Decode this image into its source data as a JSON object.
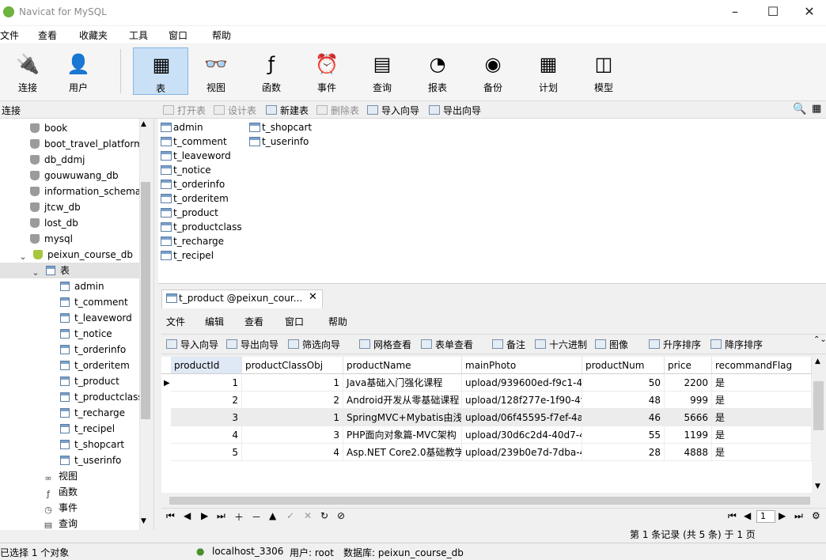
{
  "window": {
    "title": "Navicat for MySQL"
  },
  "menu": [
    "文件",
    "查看",
    "收藏夹",
    "工具",
    "窗口",
    "帮助"
  ],
  "toolbar": [
    "连接",
    "用户",
    "表",
    "视图",
    "函数",
    "事件",
    "查询",
    "报表",
    "备份",
    "计划",
    "模型"
  ],
  "object_bar": {
    "connection_label": "连接",
    "buttons": [
      "打开表",
      "设计表",
      "新建表",
      "删除表",
      "导入向导",
      "导出向导"
    ]
  },
  "tree": {
    "databases": [
      "book",
      "boot_travel_platform",
      "db_ddmj",
      "gouwuwang_db",
      "information_schema",
      "jtcw_db",
      "lost_db",
      "mysql",
      "peixun_course_db"
    ],
    "tables_folder": "表",
    "tables": [
      "admin",
      "t_comment",
      "t_leaveword",
      "t_notice",
      "t_orderinfo",
      "t_orderitem",
      "t_product",
      "t_productclass",
      "t_recharge",
      "t_recipel",
      "t_shopcart",
      "t_userinfo"
    ],
    "other_folders": [
      "视图",
      "函数",
      "事件",
      "查询"
    ]
  },
  "object_list": [
    "admin",
    "t_comment",
    "t_leaveword",
    "t_notice",
    "t_orderinfo",
    "t_orderitem",
    "t_product",
    "t_productclass",
    "t_recharge",
    "t_recipel",
    "t_shopcart",
    "t_userinfo"
  ],
  "subwindow": {
    "tab_title": "t_product @peixun_cour...",
    "menu": [
      "文件",
      "编辑",
      "查看",
      "窗口",
      "帮助"
    ],
    "tools": [
      "导入向导",
      "导出向导",
      "筛选向导",
      "网格查看",
      "表单查看",
      "备注",
      "十六进制",
      "图像",
      "升序排序",
      "降序排序"
    ]
  },
  "grid": {
    "columns": [
      "productId",
      "productClassObj",
      "productName",
      "mainPhoto",
      "productNum",
      "price",
      "recommandFlag"
    ],
    "rows": [
      [
        "1",
        "1",
        "Java基础入门强化课程",
        "upload/939600ed-f9c1-4l",
        "50",
        "2200",
        "是"
      ],
      [
        "2",
        "2",
        "Android开发从零基础课程",
        "upload/128f277e-1f90-4f",
        "48",
        "999",
        "是"
      ],
      [
        "3",
        "1",
        "SpringMVC+Mybatis由浅",
        "upload/06f45595-f7ef-4a",
        "46",
        "5666",
        "是"
      ],
      [
        "4",
        "3",
        "PHP面向对象篇-MVC架构",
        "upload/30d6c2d4-40d7-4",
        "55",
        "1199",
        "是"
      ],
      [
        "5",
        "4",
        "Asp.NET Core2.0基础教学",
        "upload/239b0e7d-7dba-4",
        "28",
        "4888",
        "是"
      ]
    ]
  },
  "navigation": {
    "page_value": "1",
    "record_status": "第 1 条记录 (共 5 条) 于 1 页"
  },
  "status": {
    "selection": "已选择 1 个对象",
    "connection": "localhost_3306",
    "user": "用户: root",
    "database": "数据库: peixun_course_db"
  }
}
